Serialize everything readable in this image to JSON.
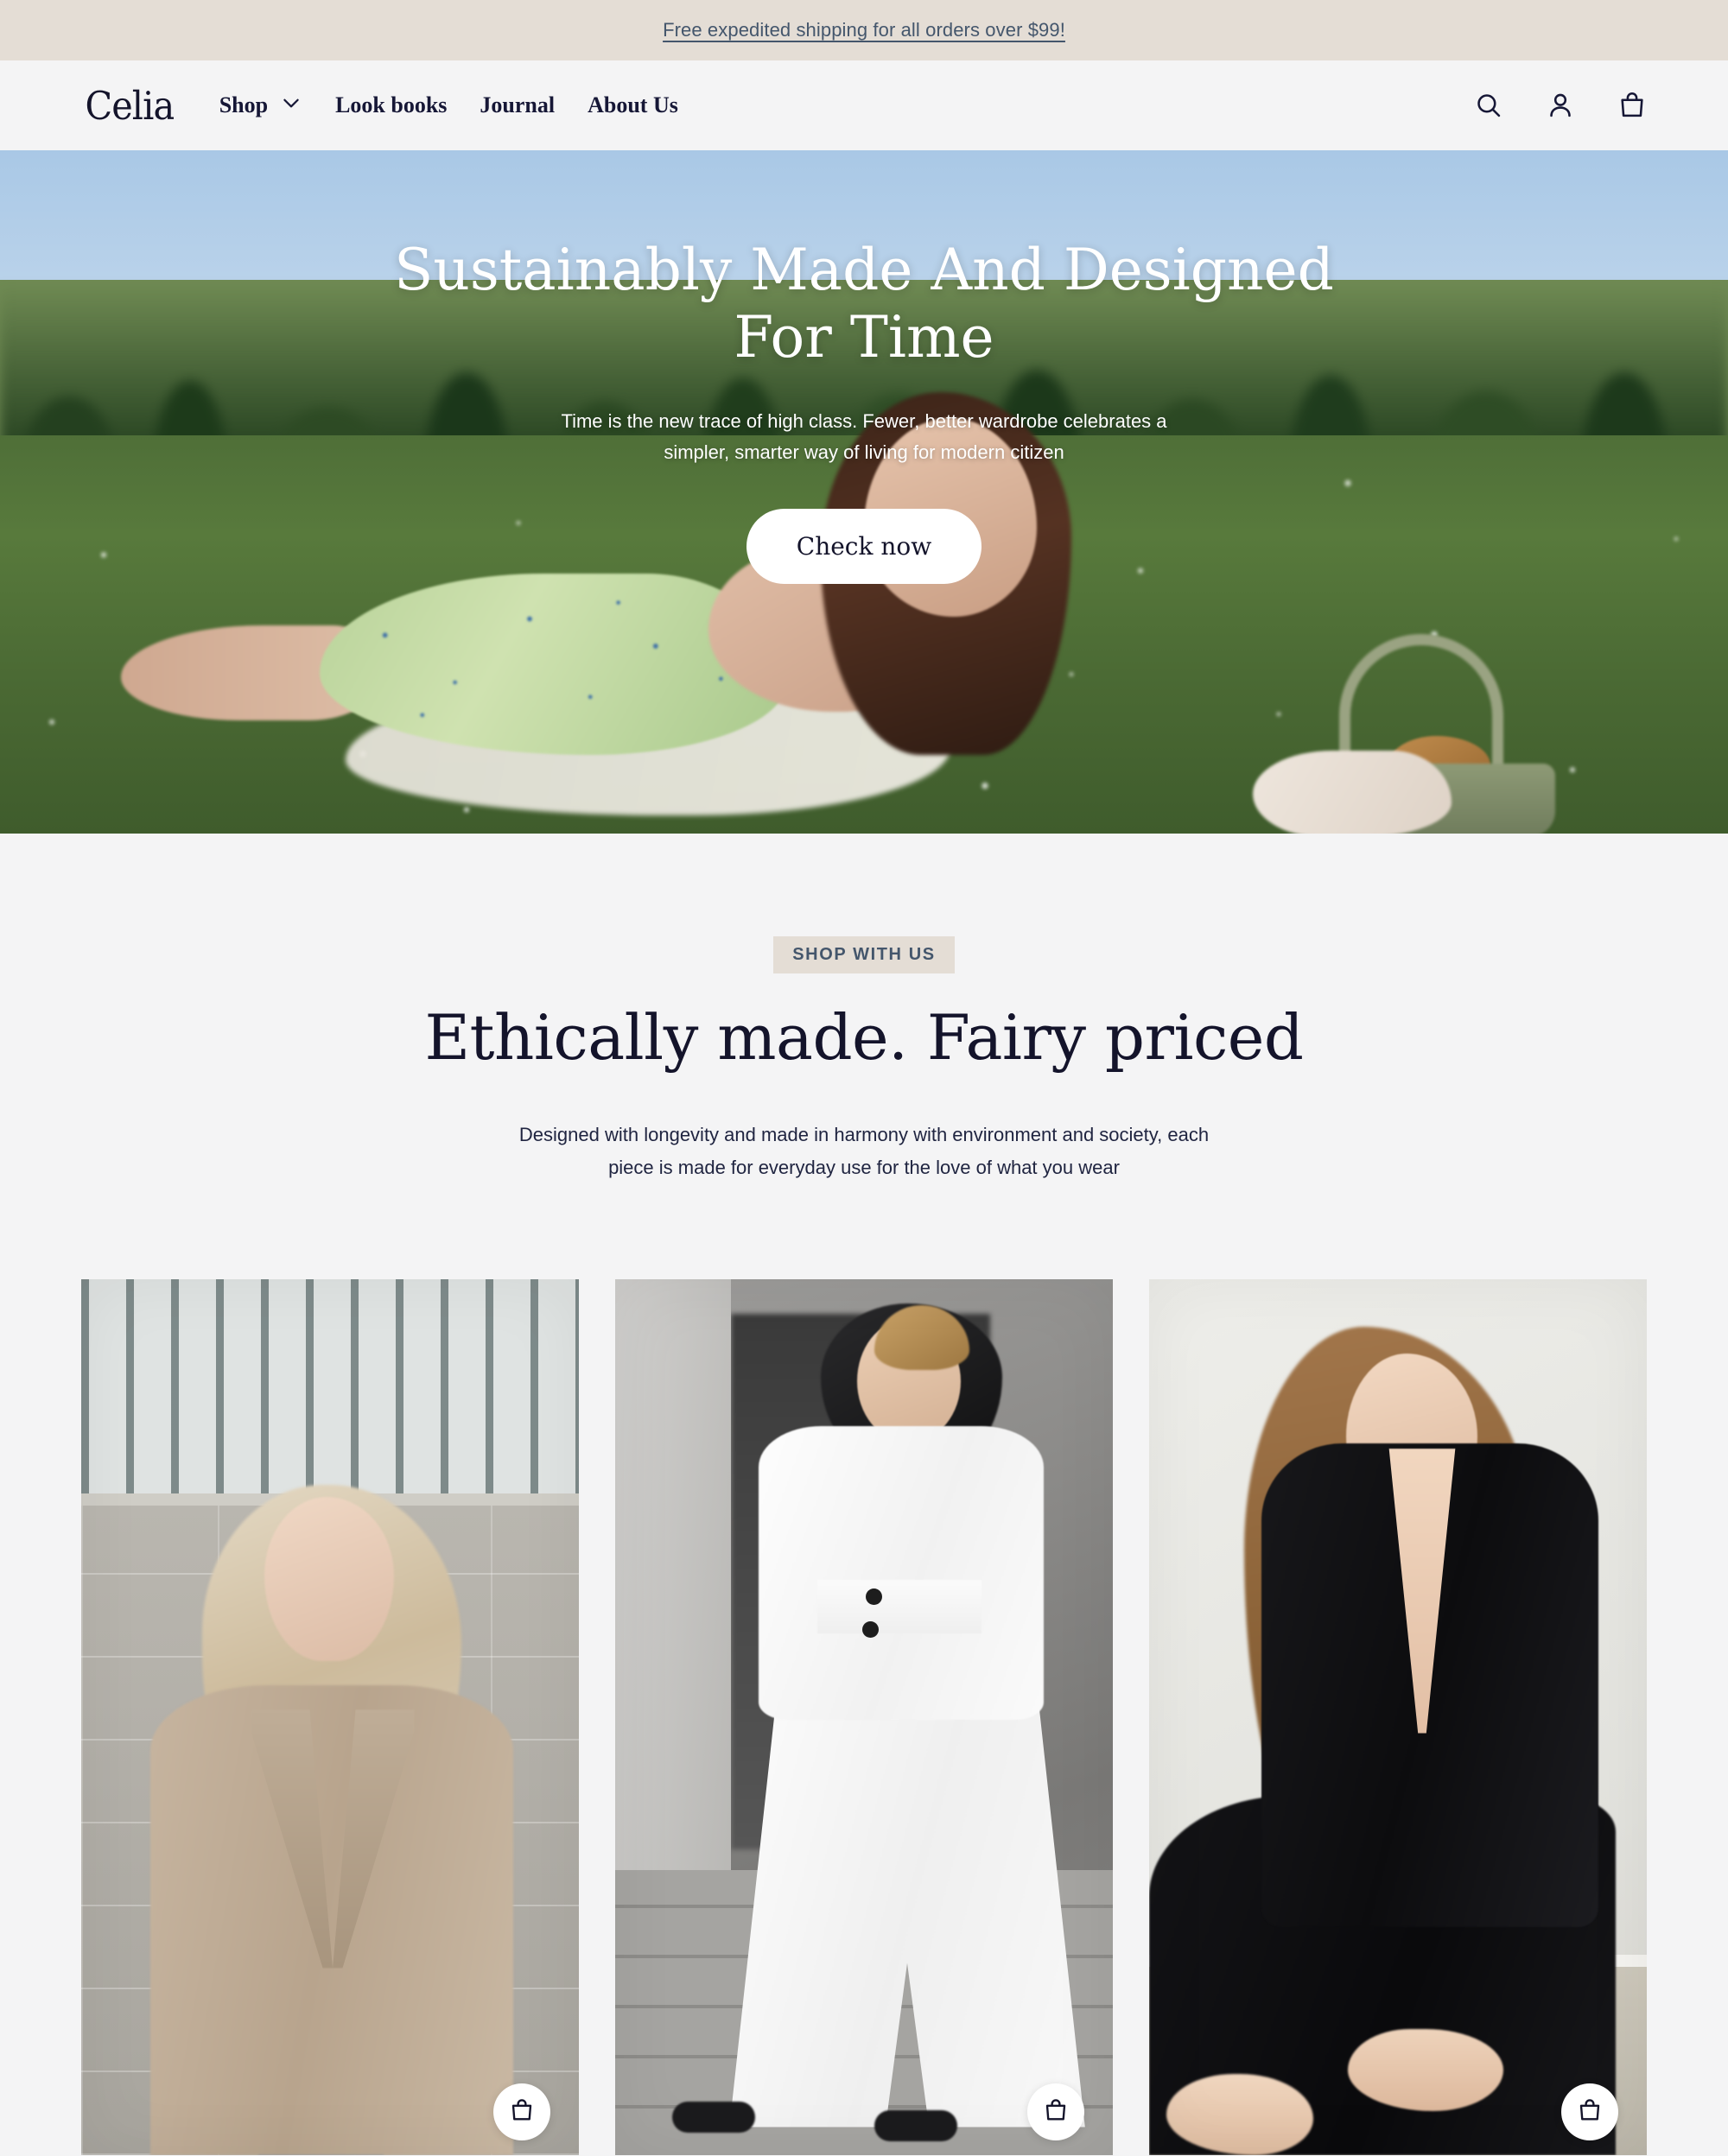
{
  "announcement": {
    "text": "Free expedited shipping for all orders over $99!"
  },
  "header": {
    "logo": "Celia",
    "nav": [
      {
        "label": "Shop",
        "icon": "chevron-down-icon",
        "has_dropdown": true
      },
      {
        "label": "Look books",
        "has_dropdown": false
      },
      {
        "label": "Journal",
        "has_dropdown": false
      },
      {
        "label": "About Us",
        "has_dropdown": false
      }
    ],
    "icons": [
      {
        "name": "search-icon",
        "label": "Search"
      },
      {
        "name": "account-icon",
        "label": "Account"
      },
      {
        "name": "shopping-bag-icon",
        "label": "Cart"
      }
    ]
  },
  "hero": {
    "title": "Sustainably Made And Designed For Time",
    "subtitle": "Time is the new trace of high class. Fewer, better wardrobe celebrates a simpler, smarter way of living for modern citizen",
    "cta_label": "Check now",
    "image_alt": "Woman in green floral dress reclining on a blanket in a flowering meadow beside a picnic basket"
  },
  "shop_section": {
    "eyebrow": "SHOP WITH US",
    "title": "Ethically made. Fairy priced",
    "description": "Designed with longevity and made in harmony with environment and society, each piece is made for everyday use for the love of what you wear",
    "products": [
      {
        "id": "product-1",
        "image_alt": "Blonde model in oversized beige blazer, white crop top and jeans against a stone wall",
        "add_to_bag_icon": "shopping-bag-icon"
      },
      {
        "id": "product-2",
        "image_alt": "Model in white belted suit and black headscarf standing on concrete steps",
        "add_to_bag_icon": "shopping-bag-icon"
      },
      {
        "id": "product-3",
        "image_alt": "Model with long brown hair in a black blazer and wide-leg trousers seated against a pale wall",
        "add_to_bag_icon": "shopping-bag-icon"
      }
    ]
  },
  "colors": {
    "announcement_bg": "#e4ddd5",
    "announcement_text": "#44566c",
    "page_bg": "#f4f4f5",
    "ink": "#14142b",
    "eyebrow_bg": "#e4ddd5",
    "eyebrow_text": "#44566c",
    "button_bg": "#ffffff"
  }
}
